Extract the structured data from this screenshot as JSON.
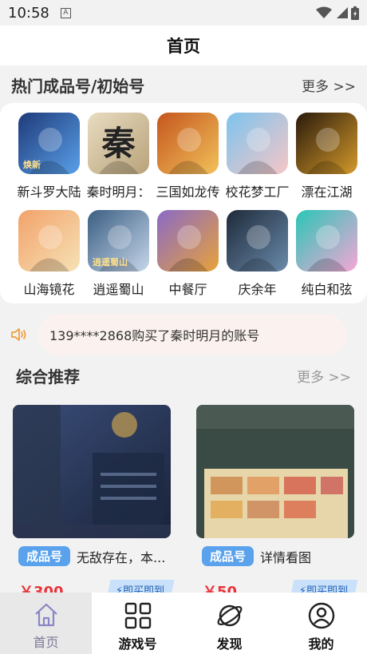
{
  "status": {
    "time": "10:58",
    "notification_glyph": "A"
  },
  "header": {
    "title": "首页"
  },
  "hot": {
    "title": "热门成品号/初始号",
    "more": "更多 >>",
    "games": [
      {
        "name": "新斗罗大陆",
        "badge": "焕新",
        "colors": [
          "#1e3a7a",
          "#5aa0e8"
        ]
      },
      {
        "name": "秦时明月：",
        "glyph": "秦",
        "colors": [
          "#e8dcc0",
          "#b8a27a"
        ]
      },
      {
        "name": "三国如龙传",
        "colors": [
          "#c4561e",
          "#f2c15a"
        ]
      },
      {
        "name": "校花梦工厂",
        "colors": [
          "#7cc4ee",
          "#f6c6c6"
        ]
      },
      {
        "name": "漂在江湖",
        "colors": [
          "#2a1a0c",
          "#d49a2a"
        ]
      },
      {
        "name": "山海镜花",
        "colors": [
          "#f2a26a",
          "#f6e2b6"
        ]
      },
      {
        "name": "逍遥蜀山",
        "badge": "逍遥蜀山",
        "colors": [
          "#3a5e82",
          "#c6d6ea"
        ]
      },
      {
        "name": "中餐厅",
        "colors": [
          "#8a6ac6",
          "#e8a23a"
        ]
      },
      {
        "name": "庆余年",
        "colors": [
          "#1e2a3a",
          "#6a8aaa"
        ]
      },
      {
        "name": "纯白和弦",
        "colors": [
          "#2ac6b6",
          "#f6a6d6"
        ]
      }
    ]
  },
  "notice": {
    "text": "139****2868购买了秦时明月的账号"
  },
  "recommend": {
    "title": "综合推荐",
    "more": "更多 >>",
    "items": [
      {
        "tag": "成品号",
        "title": "无敌存在，本...",
        "price": "￥300",
        "buy": "即买即到"
      },
      {
        "tag": "成品号",
        "title": "详情看图",
        "price": "￥50",
        "buy": "即买即到"
      }
    ]
  },
  "tabs": [
    {
      "label": "首页",
      "icon": "home-icon"
    },
    {
      "label": "游戏号",
      "icon": "grid-icon"
    },
    {
      "label": "发现",
      "icon": "planet-icon"
    },
    {
      "label": "我的",
      "icon": "user-icon"
    }
  ],
  "colors": {
    "accent": "#5aa2ec",
    "price": "#e8333a",
    "notice_bg": "#fbf2ef"
  }
}
